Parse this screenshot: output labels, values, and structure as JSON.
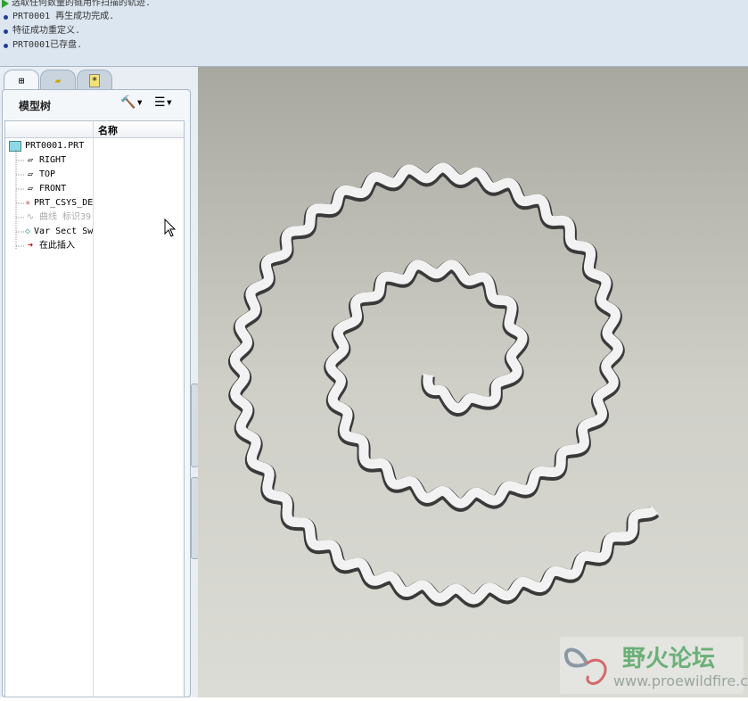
{
  "messages": [
    {
      "icon": "arrow-icon",
      "text": "选取任何数量的链用作扫描的轨迹."
    },
    {
      "icon": "bullet-icon",
      "text": "PRT0001 再生成功完成."
    },
    {
      "icon": "bullet-icon",
      "text": "特征成功重定义."
    },
    {
      "icon": "bullet-icon",
      "text": "PRT0001已存盘."
    }
  ],
  "panel": {
    "title": "模型树",
    "column_header": "名称"
  },
  "tree": [
    {
      "icon": "part-icon",
      "label": "PRT0001.PRT"
    },
    {
      "icon": "datum-plane-icon",
      "label": "RIGHT"
    },
    {
      "icon": "datum-plane-icon",
      "label": "TOP"
    },
    {
      "icon": "datum-plane-icon",
      "label": "FRONT"
    },
    {
      "icon": "csys-icon",
      "label": "PRT_CSYS_DEF"
    },
    {
      "icon": "curve-icon",
      "label": "曲线 标识39"
    },
    {
      "icon": "sweep-icon",
      "label": "Var Sect Sweep"
    },
    {
      "icon": "insert-here-icon",
      "label": "在此插入"
    }
  ],
  "watermark": {
    "title": "野火论坛",
    "url": "www.proewildfire.cn"
  }
}
